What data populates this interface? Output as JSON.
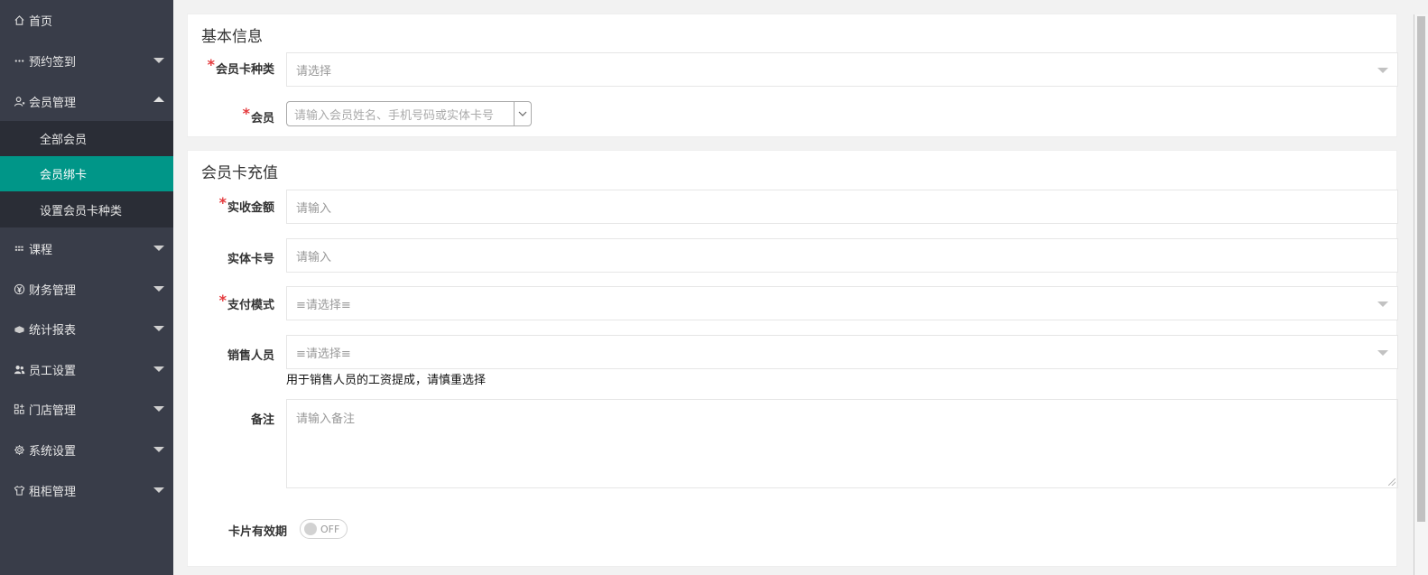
{
  "sidebar": {
    "items": [
      {
        "label": "首页",
        "icon": "home-icon"
      },
      {
        "label": "预约签到",
        "icon": "more-dots-icon"
      },
      {
        "label": "会员管理",
        "icon": "user-icon"
      },
      {
        "label": "课程",
        "icon": "grid-icon"
      },
      {
        "label": "财务管理",
        "icon": "yen-icon"
      },
      {
        "label": "统计报表",
        "icon": "chart-icon"
      },
      {
        "label": "员工设置",
        "icon": "users-icon"
      },
      {
        "label": "门店管理",
        "icon": "apps-icon"
      },
      {
        "label": "系统设置",
        "icon": "gear-icon"
      },
      {
        "label": "租柜管理",
        "icon": "shirt-icon"
      }
    ],
    "sub_items": [
      {
        "label": "全部会员"
      },
      {
        "label": "会员绑卡"
      },
      {
        "label": "设置会员卡种类"
      }
    ],
    "active_sub": "会员绑卡",
    "active_color": "#009688"
  },
  "basic": {
    "title": "基本信息",
    "card_type_label": "会员卡种类",
    "card_type_placeholder": "请选择",
    "member_label": "会员",
    "member_placeholder": "请输入会员姓名、手机号码或实体卡号"
  },
  "recharge": {
    "title": "会员卡充值",
    "amount_label": "实收金额",
    "amount_placeholder": "请输入",
    "card_no_label": "实体卡号",
    "card_no_placeholder": "请输入",
    "pay_label": "支付模式",
    "pay_placeholder": "≡请选择≡",
    "sales_label": "销售人员",
    "sales_placeholder": "≡请选择≡",
    "sales_hint": "用于销售人员的工资提成，请慎重选择",
    "remark_label": "备注",
    "remark_placeholder": "请输入备注",
    "validity_label": "卡片有效期",
    "validity_state": "OFF"
  },
  "required_mark": "*",
  "colors": {
    "required": "#e4393c",
    "sidebar_bg": "#393d49"
  }
}
